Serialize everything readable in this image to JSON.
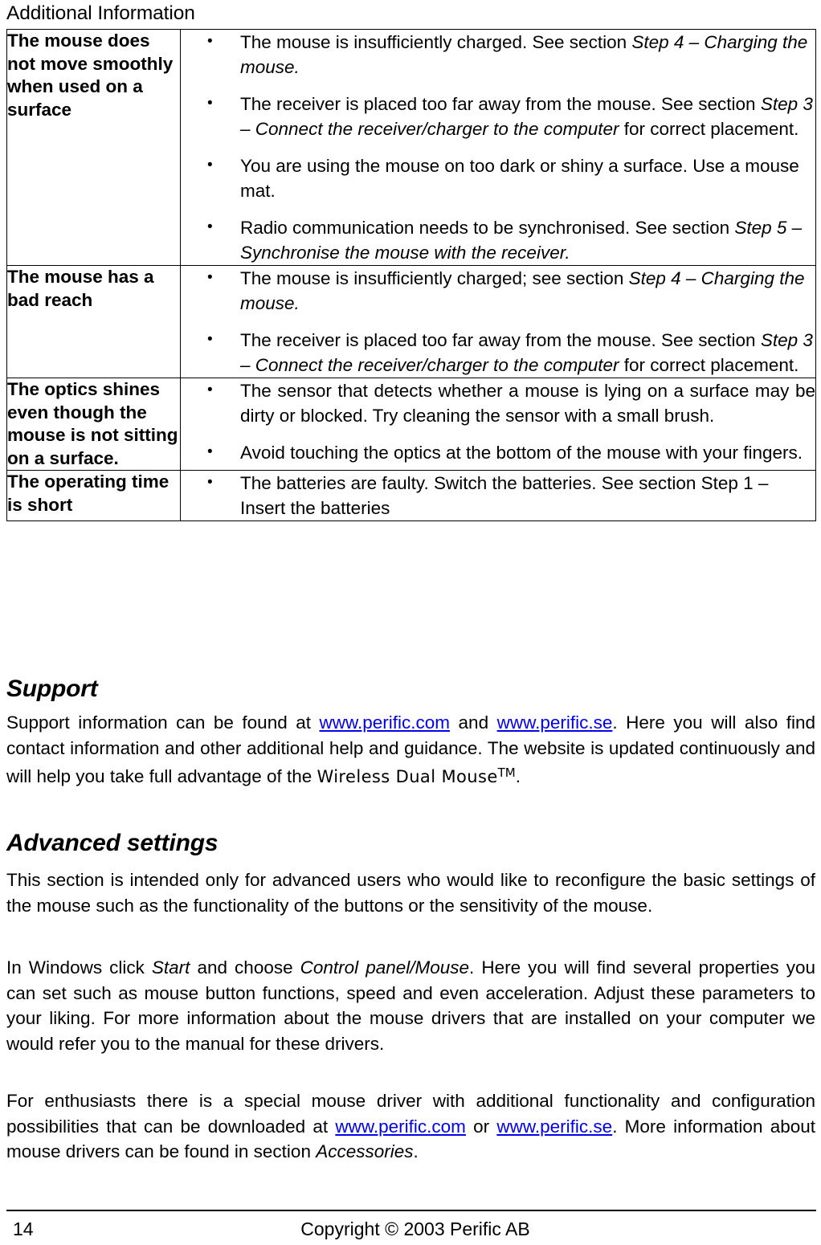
{
  "header": {
    "running_title": "Additional Information"
  },
  "table": {
    "rows": [
      {
        "symptom": "The mouse does not  move smoothly when used on a surface",
        "justify": false,
        "fixes": [
          [
            {
              "t": "The mouse is insufficiently charged. See section ",
              "i": false
            },
            {
              "t": "Step 4 – Charging the mouse.",
              "i": true
            }
          ],
          [
            {
              "t": "The receiver is placed too far away from the mouse. See section ",
              "i": false
            },
            {
              "t": "Step 3 – Connect the receiver/charger to the computer",
              "i": true
            },
            {
              "t": " for correct placement.",
              "i": false
            }
          ],
          [
            {
              "t": "You are using the mouse on too dark or shiny a surface. Use a mouse mat.",
              "i": false
            }
          ],
          [
            {
              "t": "Radio communication needs to be synchronised.  See section ",
              "i": false
            },
            {
              "t": "Step 5 – Synchronise the mouse with the receiver.",
              "i": true
            }
          ]
        ]
      },
      {
        "symptom": "The mouse has a bad reach",
        "justify": false,
        "fixes": [
          [
            {
              "t": "The mouse is insufficiently charged; see section ",
              "i": false
            },
            {
              "t": "Step 4 – Charging the mouse.",
              "i": true
            }
          ],
          [
            {
              "t": "The receiver is placed too far away from the mouse. See section ",
              "i": false
            },
            {
              "t": "Step 3 – Connect the receiver/charger to the computer",
              "i": true
            },
            {
              "t": " for correct placement.",
              "i": false
            }
          ]
        ]
      },
      {
        "symptom": "The optics shines even though the mouse is not sitting on a surface.",
        "justify": true,
        "fixes": [
          [
            {
              "t": "The sensor that detects whether a mouse is lying on a surface may be dirty or blocked. Try cleaning the sensor with a small brush.",
              "i": false
            }
          ],
          [
            {
              "t": "Avoid touching the optics at the bottom of the mouse with your fingers.",
              "i": false
            }
          ]
        ]
      },
      {
        "symptom": "The operating time is short",
        "justify": false,
        "fixes": [
          [
            {
              "t": "The batteries are faulty. Switch the batteries. See section Step 1 – Insert the batteries",
              "i": false
            }
          ]
        ]
      }
    ]
  },
  "support": {
    "heading": "Support",
    "text_1": "Support information can be found at ",
    "link_1": "www.perific.com",
    "text_2": " and ",
    "link_2": "www.perific.se",
    "text_3": ". Here you will also find contact information and other additional help and guidance. The website is updated continuously and will help you take full advantage of the ",
    "brand": "Wireless Dual Mouse",
    "brand_tm": "TM",
    "text_4": "."
  },
  "advanced": {
    "heading": "Advanced settings",
    "p1": "This section is intended only for advanced users who would like to reconfigure the basic settings of the mouse such as the functionality of the buttons or the sensitivity of the mouse.",
    "p2_a": "In Windows click ",
    "p2_i1": "Start",
    "p2_b": " and choose ",
    "p2_i2": "Control panel/Mouse",
    "p2_c": ". Here you will find several properties you can set such as mouse button functions, speed and even acceleration. Adjust these parameters to your liking. For more information about the mouse drivers that are installed on your computer we would refer you to the manual for these drivers.",
    "p3_a": "For enthusiasts there is a special mouse driver with additional functionality and configuration possibilities that can be downloaded at ",
    "p3_link1": "www.perific.com",
    "p3_b": " or ",
    "p3_link2": "www.perific.se",
    "p3_c": ". More information about mouse drivers can be found in section ",
    "p3_i": "Accessories",
    "p3_d": "."
  },
  "footer": {
    "page_number": "14",
    "copyright": "Copyright © 2003 Perific AB"
  },
  "colors": {
    "link": "#0000ee",
    "text": "#000000",
    "rule": "#000000"
  }
}
